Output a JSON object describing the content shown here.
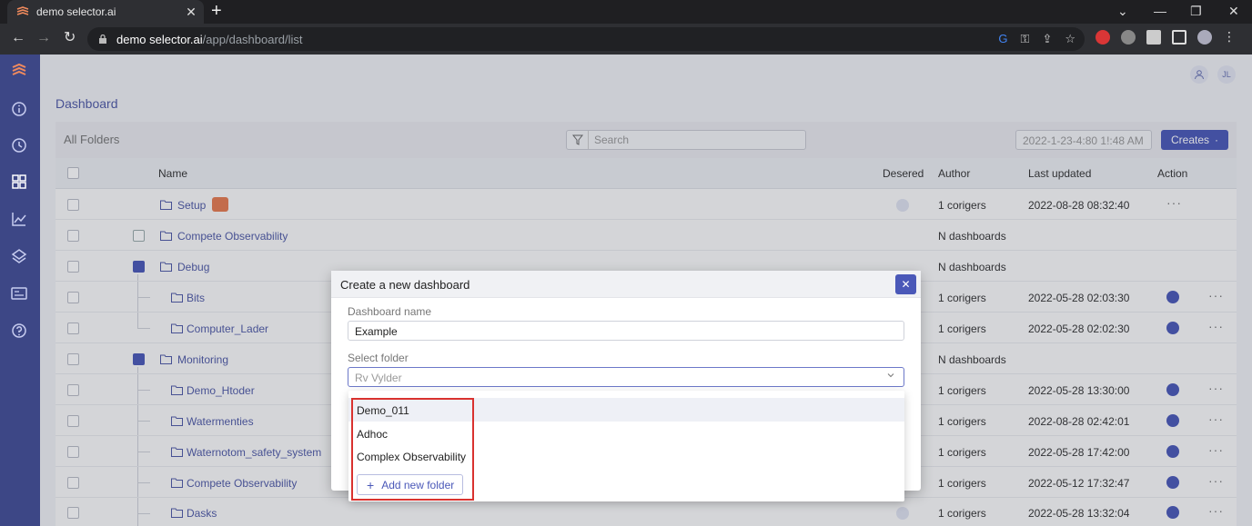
{
  "browser": {
    "tab_title": "demo selector.ai",
    "tab_close": "✕",
    "new_tab": "+",
    "url_host": "demo selector.ai",
    "url_path": "/app/dashboard/list",
    "win_min": "—",
    "win_restore": "❐",
    "win_close": "✕"
  },
  "header": {
    "user_initials": "JL"
  },
  "page": {
    "title": "Dashboard",
    "all_folders": "All Folders",
    "search_placeholder": "Search",
    "date_value": "2022-1-23-4:80  1!:48 AM",
    "create_label": "Creates",
    "create_caret": "·"
  },
  "table": {
    "headers": {
      "name": "Name",
      "desired": "Desered",
      "author": "Author",
      "updated": "Last updated",
      "action": "Action"
    },
    "rows": [
      {
        "name": "Setup",
        "author": "1 corigers",
        "updated": "2022-08-28 08:32:40"
      },
      {
        "name": "Compete Observability",
        "author": "N dashboards",
        "updated": ""
      },
      {
        "name": "Debug",
        "author": "N dashboards",
        "updated": ""
      },
      {
        "name": "Bits",
        "author": "1 corigers",
        "updated": "2022-05-28 02:03:30"
      },
      {
        "name": "Computer_Lader",
        "author": "1 corigers",
        "updated": "2022-05-28 02:02:30"
      },
      {
        "name": "Monitoring",
        "author": "N dashboards",
        "updated": ""
      },
      {
        "name": "Demo_Htoder",
        "author": "1 corigers",
        "updated": "2022-05-28 13:30:00"
      },
      {
        "name": "Watermenties",
        "author": "1 corigers",
        "updated": "2022-08-28 02:42:01"
      },
      {
        "name": "Waternotom_safety_system",
        "author": "1 corigers",
        "updated": "2022-05-28 17:42:00"
      },
      {
        "name": "Compete Observability",
        "author": "1 corigers",
        "updated": "2022-05-12 17:32:47"
      },
      {
        "name": "Dasks",
        "author": "1 corigers",
        "updated": "2022-05-28 13:32:04"
      }
    ]
  },
  "modal": {
    "title": "Create a new dashboard",
    "close": "✕",
    "name_label": "Dashboard name",
    "name_value": "Example",
    "folder_label": "Select folder",
    "folder_placeholder": "Rv Vylder",
    "options": [
      "Demo_011",
      "Adhoc",
      "Complex Observability"
    ],
    "add_folder": "Add new folder",
    "add_plus": "+"
  },
  "colors": {
    "accent": "#4a58b8",
    "sidebar": "#3d4786",
    "highlight": "#d9322f"
  }
}
